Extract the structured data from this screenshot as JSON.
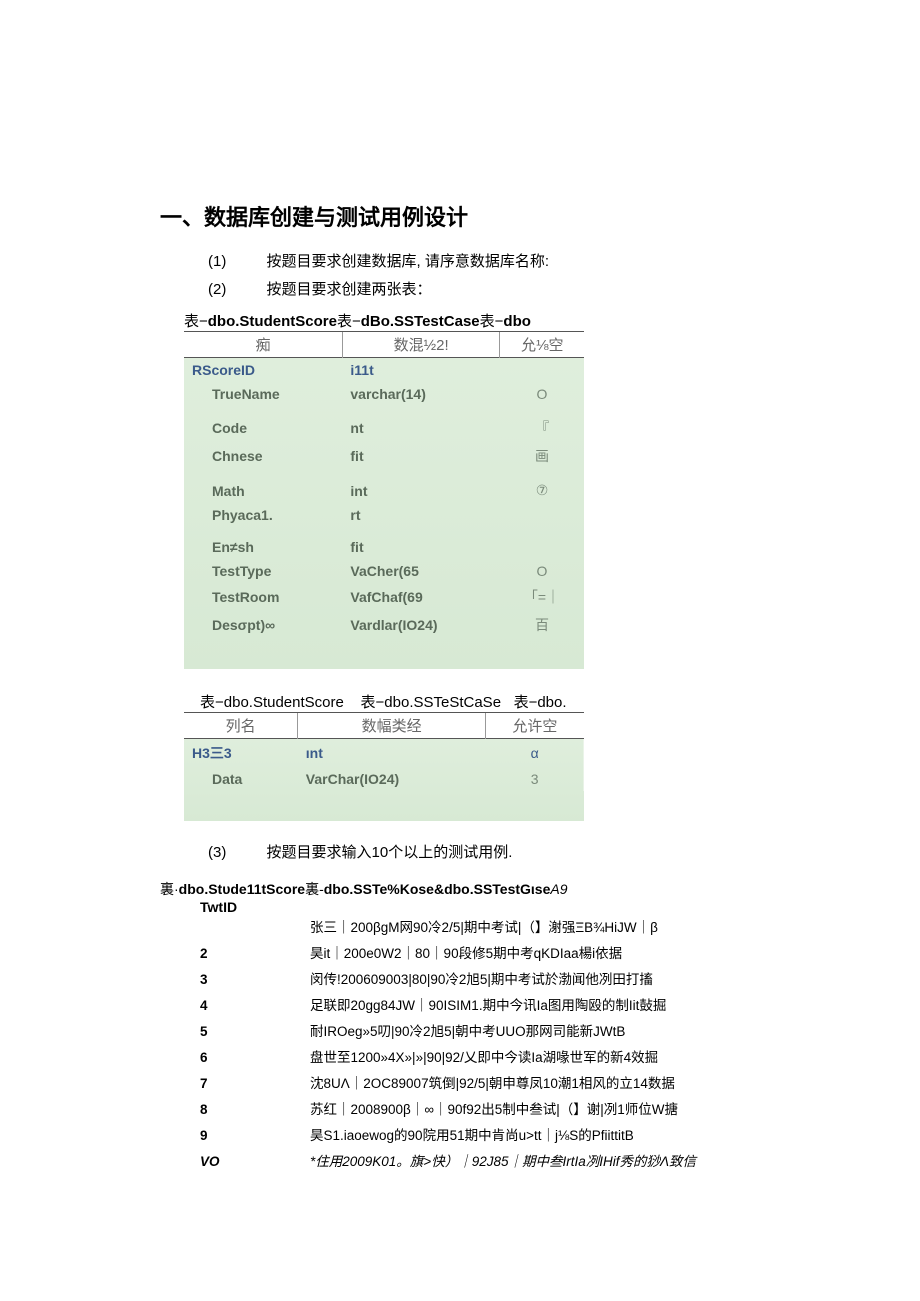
{
  "heading": "一、数据库创建与测试用例设计",
  "steps": {
    "s1_num": "(1)",
    "s1_text": "按题目要求创建数据库, 请序意数据库名称:",
    "s2_num": "(2)",
    "s2_text": "按题目要求创建两张表：",
    "s3_num": "(3)",
    "s3_text": "按题目要求输入10个以上的测试用例."
  },
  "table1": {
    "caption_prefix": "表−",
    "caption_a": "dbo.StudentScore",
    "caption_mid1": "表−",
    "caption_b": "dBo.SSTestCase",
    "caption_mid2": "表−",
    "caption_c": "dbo",
    "head_col1": "痴",
    "head_col2": "数混½2!",
    "head_col3": "允⅛空",
    "rows": [
      {
        "name": "RScoreID",
        "type": "i11t",
        "allow": "",
        "first": true
      },
      {
        "name": "TrueName",
        "type": "varchar(14)",
        "allow": "O"
      },
      {
        "name": "Code",
        "type": "nt",
        "allow": "『"
      },
      {
        "name": "Chnese",
        "type": "fit",
        "allow": "画"
      },
      {
        "name": "Math",
        "type": "int",
        "allow": "⑦"
      },
      {
        "name": "Phyaca1.",
        "type": "rt",
        "allow": ""
      },
      {
        "name": "En≠sh",
        "type": "fit",
        "allow": ""
      },
      {
        "name": "TestType",
        "type": "VaCher(65",
        "allow": "O"
      },
      {
        "name": "TestRoom",
        "type": "VafChaf(69",
        "allow": "「=｜"
      },
      {
        "name": "Desσpt)∞",
        "type": "Vardlar(IO24)",
        "allow": "百"
      }
    ]
  },
  "table2": {
    "caption_a": "表−dbo.StudentScore",
    "caption_b": "表−dbo.SSTeStCaSe",
    "caption_c": "表−dbo.",
    "head_col1": "列名",
    "head_col2": "数幅类经",
    "head_col3": "允许空",
    "rows": [
      {
        "name": "H3三3",
        "type": "ınt",
        "allow": "α",
        "first": true
      },
      {
        "name": "Data",
        "type": "VarChar(IO24)",
        "allow": "3"
      }
    ]
  },
  "tests": {
    "caption_prefix": "裏·",
    "caption_a": "dbo.Stυde11tScore",
    "caption_mid": "裏-",
    "caption_b": "dbo.SSTe%Kose&dbo.SSTestGιse",
    "caption_suffix": "A9",
    "id_label": "TwtID",
    "rows": [
      {
        "num": "",
        "data": "张三｜200βgM网90冷2/5|期中考试|（】㴬强ΞB¾HiJW｜β"
      },
      {
        "num": "2",
        "data": "昊it｜200e0W2｜80｜90段修5期中考qKDIaa楊i依据"
      },
      {
        "num": "3",
        "data": "闵传!200609003|80|90冷2旭5|期中考试於渤闻他冽田打搐"
      },
      {
        "num": "4",
        "data": "足联即20gg84JW｜90ISIM1.期中今讯Ia图用陶殴的制Iit鼔掘"
      },
      {
        "num": "5",
        "data": "耐IROeg»5叨|90冷2旭5|朝中考UUO那网司能新JWtB"
      },
      {
        "num": "6",
        "data": "盘世至1200»4X»|»|90|92/乂即中今读Ia湖喙世军的新4效掘"
      },
      {
        "num": "7",
        "data": "沈8UΛ｜2OC89007筑倒|92/5|朝申尊凤10潮1相风的立14数据"
      },
      {
        "num": "8",
        "data": "苏红｜2008900β｜∞｜90f92出5制中叁试|（】谢|冽1师位W搪"
      },
      {
        "num": "9",
        "data": "昊S1.iaoewog的90院用51期中肯尚u>tt｜j⅛S的PfiittitB"
      },
      {
        "num": "VO",
        "data": "*住用2009K01。旗>快）｜92J85｜期中叁IrtIa冽IHif秀的猀Λ致信",
        "italic": true
      }
    ]
  }
}
